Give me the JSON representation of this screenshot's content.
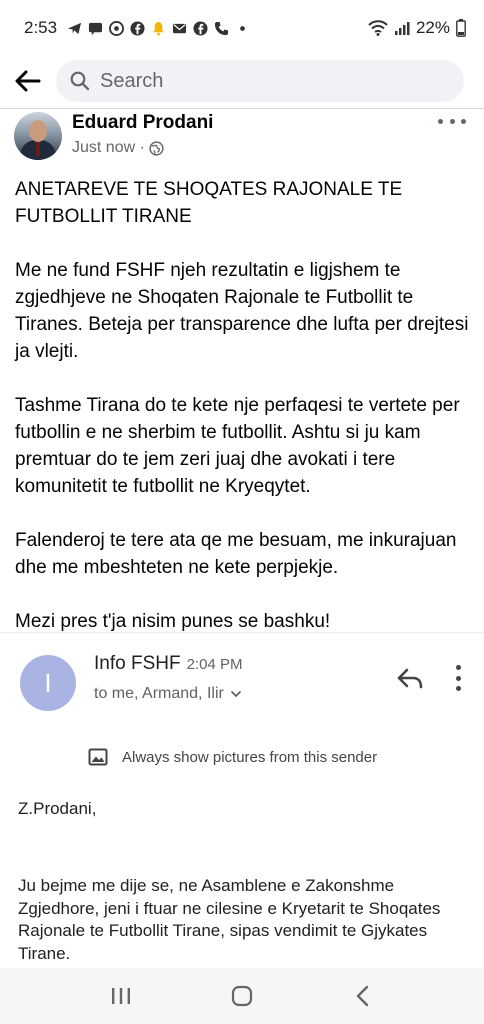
{
  "status_bar": {
    "time": "2:53",
    "battery": "22%",
    "icons": [
      "telegram-icon",
      "message-icon",
      "chrome-icon",
      "facebook-icon",
      "bell-icon",
      "mail-icon",
      "facebook-icon",
      "phone-icon",
      "dot-icon",
      "wifi-icon",
      "signal-icon",
      "battery-icon"
    ]
  },
  "search": {
    "placeholder": "Search"
  },
  "post": {
    "author": "Eduard Prodani",
    "time": "Just now ·",
    "privacy_icon": "globe-icon",
    "paragraphs": [
      "ANETAREVE TE SHOQATES RAJONALE TE FUTBOLLIT TIRANE",
      "Me ne fund FSHF njeh rezultatin e ligjshem te zgjedhjeve ne Shoqaten Rajonale te Futbollit te Tiranes. Beteja per transparence dhe lufta per drejtesi ja vlejti.",
      "Tashme Tirana do te kete nje perfaqesi te vertete per futbollin e ne sherbim te futbollit. Ashtu si ju kam premtuar do te jem zeri juaj dhe avokati i tere komunitetit te futbollit ne Kryeqytet.",
      "Falenderoj te tere ata qe me besuam, me inkurajuan dhe me mbeshteten ne kete perpjekje.",
      "Mezi pres t'ja nisim punes se bashku!"
    ]
  },
  "email": {
    "avatar_letter": "I",
    "sender": "Info FSHF",
    "time": "2:04 PM",
    "recipients": "to me, Armand, Ilir",
    "show_pictures": "Always show pictures from this sender",
    "greeting": "Z.Prodani,",
    "body": "Ju bejme me dije se, ne Asamblene e Zakonshme Zgjedhore, jeni i ftuar ne cilesine e Kryetarit te Shoqates Rajonale te Futbollit Tirane, sipas vendimit te Gjykates Tirane."
  },
  "colors": {
    "email_avatar": "#a9b4e2",
    "search_bg": "#f0f2f5",
    "secondary_text": "#65676b"
  }
}
